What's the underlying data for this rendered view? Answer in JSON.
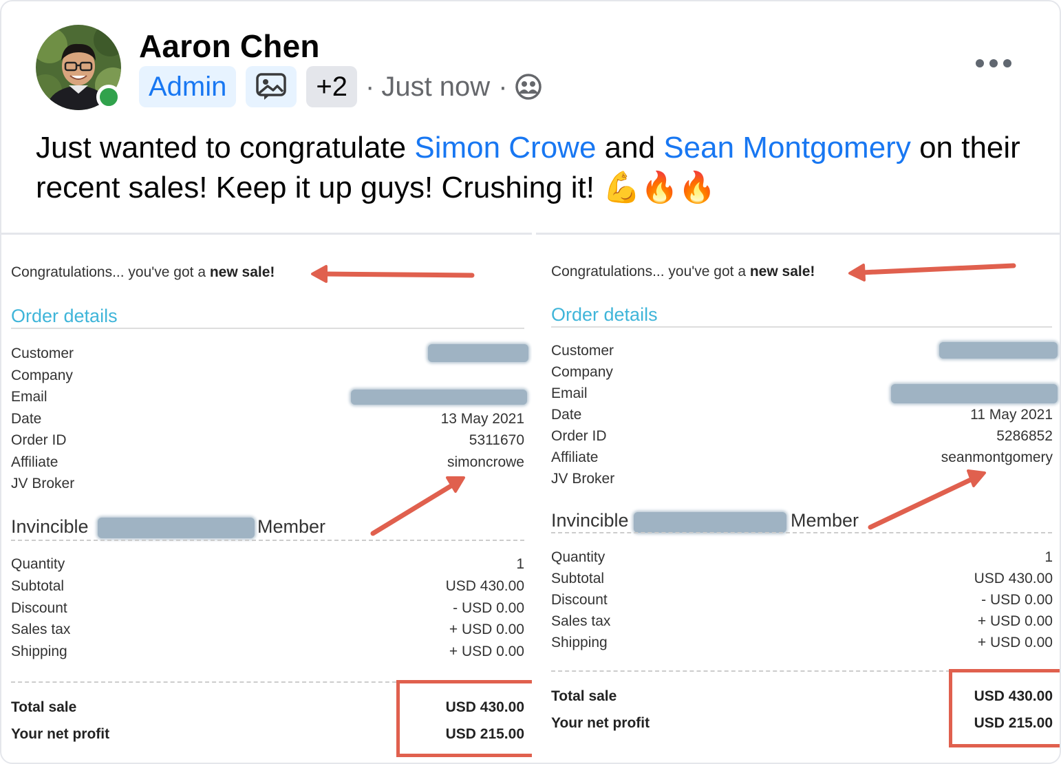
{
  "post": {
    "author": "Aaron Chen",
    "badges": {
      "role": "Admin",
      "media_icon": "photo-gallery-icon",
      "more_count": "+2"
    },
    "separator": "·",
    "time": "Just now",
    "audience_icon": "group-audience-icon",
    "text": {
      "part1": "Just wanted to congratulate ",
      "mention1": "Simon Crowe",
      "part2": " and ",
      "mention2": "Sean Montgomery",
      "part3": " on their recent sales! Keep it up guys! Crushing it! ",
      "emojis": "💪🔥🔥"
    }
  },
  "receipts": [
    {
      "congrats_prefix": "Congratulations... you've got a ",
      "congrats_bold": "new sale!",
      "order_title": "Order details",
      "labels": [
        "Customer",
        "Company",
        "Email",
        "Date",
        "Order ID",
        "Affiliate",
        "JV Broker"
      ],
      "date": "13 May 2021",
      "order_id": "5311670",
      "affiliate": "simoncrowe",
      "product_prefix": "Invincible",
      "product_suffix": "Member",
      "line_labels": [
        "Quantity",
        "Subtotal",
        "Discount",
        "Sales tax",
        "Shipping"
      ],
      "line_values": [
        "1",
        "USD 430.00",
        "- USD 0.00",
        "+ USD 0.00",
        "+ USD 0.00"
      ],
      "total_label": "Total sale",
      "total_value": "USD 430.00",
      "profit_label": "Your net profit",
      "profit_value": "USD 215.00"
    },
    {
      "congrats_prefix": "Congratulations... you've got a ",
      "congrats_bold": "new sale!",
      "order_title": "Order details",
      "labels": [
        "Customer",
        "Company",
        "Email",
        "Date",
        "Order ID",
        "Affiliate",
        "JV Broker"
      ],
      "date": "11 May 2021",
      "order_id": "5286852",
      "affiliate": "seanmontgomery",
      "product_prefix": "Invincible",
      "product_suffix": "Member",
      "line_labels": [
        "Quantity",
        "Subtotal",
        "Discount",
        "Sales tax",
        "Shipping"
      ],
      "line_values": [
        "1",
        "USD 430.00",
        "- USD 0.00",
        "+ USD 0.00",
        "+ USD 0.00"
      ],
      "total_label": "Total sale",
      "total_value": "USD 430.00",
      "profit_label": "Your net profit",
      "profit_value": "USD 215.00"
    }
  ],
  "colors": {
    "link": "#1877f2",
    "online": "#31a24c",
    "order_title": "#3fb5d9",
    "annotation": "#e0604e",
    "redaction": "#9fb3c3"
  }
}
